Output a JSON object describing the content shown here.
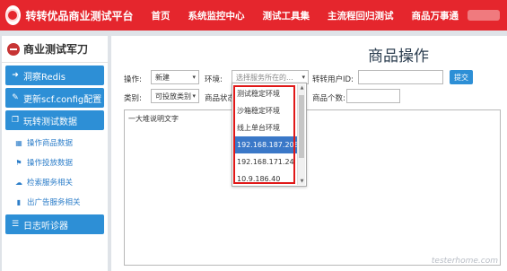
{
  "header": {
    "brand": "转转优品商业测试平台",
    "nav": [
      "首页",
      "系统监控中心",
      "测试工具集",
      "主流程回归测试",
      "商品万事通"
    ]
  },
  "sidebar": {
    "title": "商业测试军刀",
    "btn_redis": "洞察Redis",
    "btn_config": "更新scf.config配置",
    "btn_data": "玩转测试数据",
    "sub_items": [
      "操作商品数据",
      "操作投放数据",
      "检索服务相关",
      "出广告服务相关"
    ],
    "btn_log": "日志听诊器"
  },
  "form": {
    "page_title": "商品操作",
    "op_label": "操作:",
    "op_value": "新建",
    "env_label": "环境:",
    "env_placeholder": "选择服务所在的...",
    "uid_label": "转转用户ID:",
    "submit_label": "提交",
    "cat_label": "类别:",
    "cat_value": "可投放类别",
    "status_label": "商品状态",
    "count_label": "商品个数:",
    "textarea_text": "一大堆说明文字"
  },
  "dropdown": {
    "options": [
      "测试稳定环境",
      "沙箱稳定环境",
      "线上单台环境",
      "192.168.187.208",
      "192.168.171.24",
      "10.9.186.40"
    ],
    "selected_index": 3,
    "scroll_up": "▲",
    "scroll_down": "▼"
  },
  "icons": {
    "redis": "circle-arrow-icon",
    "config": "edit-icon",
    "data": "copy-icon",
    "log": "list-icon",
    "caret": "▾"
  },
  "colors": {
    "topbar": "#e5262d",
    "accent": "#2d8fd6",
    "selected": "#3a78c8",
    "highlight": "#e01818"
  },
  "watermark": "testerhome.com"
}
